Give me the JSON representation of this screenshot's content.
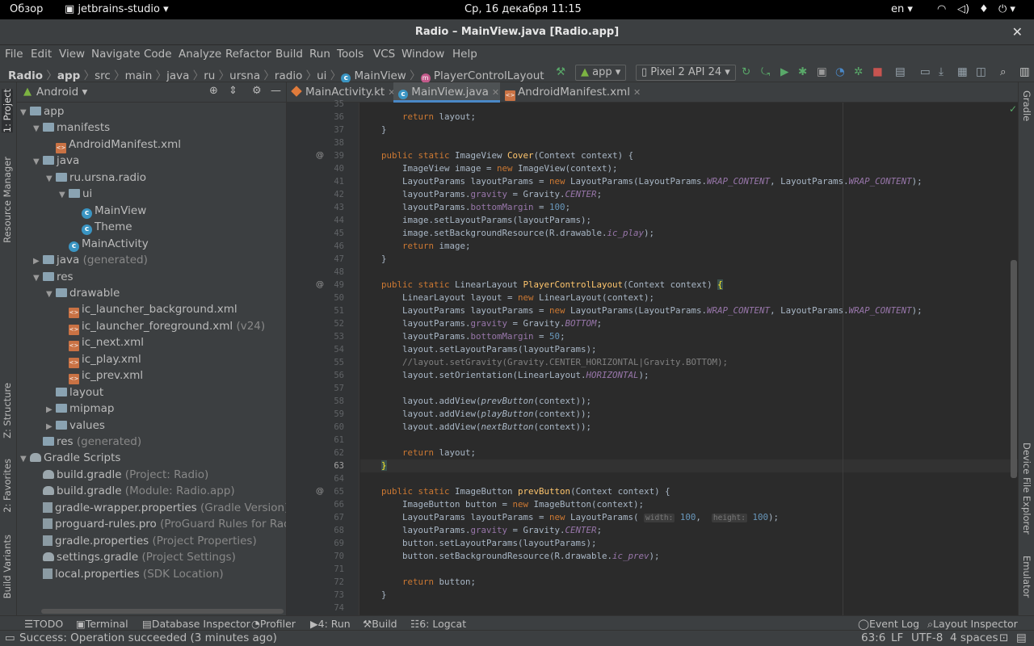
{
  "system_bar": {
    "overview": "Обзор",
    "app_name": "jetbrains-studio",
    "datetime": "Ср, 16 декабря  11:15",
    "lang": "en"
  },
  "window": {
    "title": "Radio – MainView.java [Radio.app]"
  },
  "menu": [
    "File",
    "Edit",
    "View",
    "Navigate",
    "Code",
    "Analyze",
    "Refactor",
    "Build",
    "Run",
    "Tools",
    "VCS",
    "Window",
    "Help"
  ],
  "breadcrumb": [
    "Radio",
    "app",
    "src",
    "main",
    "java",
    "ru",
    "ursna",
    "radio",
    "ui",
    "MainView",
    "PlayerControlLayout"
  ],
  "run_config": {
    "module": "app",
    "device": "Pixel 2 API 24"
  },
  "left_stripe": [
    "1: Project",
    "Resource Manager",
    "Z: Structure",
    "2: Favorites",
    "Build Variants"
  ],
  "right_stripe": [
    "Gradle",
    "Device File Explorer",
    "Emulator"
  ],
  "project_view": "Android",
  "tree": [
    {
      "label": "app",
      "hint": "",
      "depth": 0,
      "arrow": "▼",
      "icon": "folder"
    },
    {
      "label": "manifests",
      "hint": "",
      "depth": 1,
      "arrow": "▼",
      "icon": "folder"
    },
    {
      "label": "AndroidManifest.xml",
      "hint": "",
      "depth": 2,
      "arrow": "",
      "icon": "xml"
    },
    {
      "label": "java",
      "hint": "",
      "depth": 1,
      "arrow": "▼",
      "icon": "folder"
    },
    {
      "label": "ru.ursna.radio",
      "hint": "",
      "depth": 2,
      "arrow": "▼",
      "icon": "folder"
    },
    {
      "label": "ui",
      "hint": "",
      "depth": 3,
      "arrow": "▼",
      "icon": "folder"
    },
    {
      "label": "MainView",
      "hint": "",
      "depth": 4,
      "arrow": "",
      "icon": "class"
    },
    {
      "label": "Theme",
      "hint": "",
      "depth": 4,
      "arrow": "",
      "icon": "class"
    },
    {
      "label": "MainActivity",
      "hint": "",
      "depth": 3,
      "arrow": "",
      "icon": "class"
    },
    {
      "label": "java",
      "hint": " (generated)",
      "depth": 1,
      "arrow": "▶",
      "icon": "folder"
    },
    {
      "label": "res",
      "hint": "",
      "depth": 1,
      "arrow": "▼",
      "icon": "folder"
    },
    {
      "label": "drawable",
      "hint": "",
      "depth": 2,
      "arrow": "▼",
      "icon": "folder"
    },
    {
      "label": "ic_launcher_background.xml",
      "hint": "",
      "depth": 3,
      "arrow": "",
      "icon": "xml"
    },
    {
      "label": "ic_launcher_foreground.xml",
      "hint": " (v24)",
      "depth": 3,
      "arrow": "",
      "icon": "xml"
    },
    {
      "label": "ic_next.xml",
      "hint": "",
      "depth": 3,
      "arrow": "",
      "icon": "xml"
    },
    {
      "label": "ic_play.xml",
      "hint": "",
      "depth": 3,
      "arrow": "",
      "icon": "xml"
    },
    {
      "label": "ic_prev.xml",
      "hint": "",
      "depth": 3,
      "arrow": "",
      "icon": "xml"
    },
    {
      "label": "layout",
      "hint": "",
      "depth": 2,
      "arrow": "",
      "icon": "folder"
    },
    {
      "label": "mipmap",
      "hint": "",
      "depth": 2,
      "arrow": "▶",
      "icon": "folder"
    },
    {
      "label": "values",
      "hint": "",
      "depth": 2,
      "arrow": "▶",
      "icon": "folder"
    },
    {
      "label": "res",
      "hint": " (generated)",
      "depth": 1,
      "arrow": "",
      "icon": "folder"
    },
    {
      "label": "Gradle Scripts",
      "hint": "",
      "depth": 0,
      "arrow": "▼",
      "icon": "gradle"
    },
    {
      "label": "build.gradle",
      "hint": " (Project: Radio)",
      "depth": 1,
      "arrow": "",
      "icon": "gradle"
    },
    {
      "label": "build.gradle",
      "hint": " (Module: Radio.app)",
      "depth": 1,
      "arrow": "",
      "icon": "gradle"
    },
    {
      "label": "gradle-wrapper.properties",
      "hint": " (Gradle Version)",
      "depth": 1,
      "arrow": "",
      "icon": "props"
    },
    {
      "label": "proguard-rules.pro",
      "hint": " (ProGuard Rules for Radio.a",
      "depth": 1,
      "arrow": "",
      "icon": "props"
    },
    {
      "label": "gradle.properties",
      "hint": " (Project Properties)",
      "depth": 1,
      "arrow": "",
      "icon": "props"
    },
    {
      "label": "settings.gradle",
      "hint": " (Project Settings)",
      "depth": 1,
      "arrow": "",
      "icon": "gradle"
    },
    {
      "label": "local.properties",
      "hint": " (SDK Location)",
      "depth": 1,
      "arrow": "",
      "icon": "props"
    }
  ],
  "tabs": [
    {
      "label": "MainActivity.kt",
      "active": false,
      "icon": "kotlin"
    },
    {
      "label": "MainView.java",
      "active": true,
      "icon": "class"
    },
    {
      "label": "AndroidManifest.xml",
      "active": false,
      "icon": "xml"
    }
  ],
  "code_lines": [
    {
      "n": "35",
      "html": ""
    },
    {
      "n": "36",
      "html": "        <span class=\"kw\">return</span> layout;"
    },
    {
      "n": "37",
      "html": "    }"
    },
    {
      "n": "38",
      "html": ""
    },
    {
      "n": "39",
      "html": "    <span class=\"kw\">public static</span> ImageView <span class=\"fn\">Cover</span>(Context context) {",
      "mark": "@"
    },
    {
      "n": "40",
      "html": "        ImageView image = <span class=\"kw\">new</span> ImageView(context);"
    },
    {
      "n": "41",
      "html": "        LayoutParams layoutParams = <span class=\"kw\">new</span> LayoutParams(LayoutParams.<span class=\"st\">WRAP_CONTENT</span>, LayoutParams.<span class=\"st\">WRAP_CONTENT</span>);"
    },
    {
      "n": "42",
      "html": "        layoutParams.<span class=\"st\" style=\"font-style:normal\">gravity</span> = Gravity.<span class=\"st\">CENTER</span>;"
    },
    {
      "n": "43",
      "html": "        layoutParams.<span class=\"st\" style=\"font-style:normal\">bottomMargin</span> = <span class=\"num\">100</span>;"
    },
    {
      "n": "44",
      "html": "        image.setLayoutParams(layoutParams);"
    },
    {
      "n": "45",
      "html": "        image.setBackgroundResource(R.drawable.<span class=\"st\">ic_play</span>);"
    },
    {
      "n": "46",
      "html": "        <span class=\"kw\">return</span> image;"
    },
    {
      "n": "47",
      "html": "    }"
    },
    {
      "n": "48",
      "html": ""
    },
    {
      "n": "49",
      "html": "    <span class=\"kw\">public static</span> LinearLayout <span class=\"fn\">PlayerControlLayout</span>(Context context) <span style=\"background:#3b514d;color:#ffef28\">{</span>",
      "mark": "@"
    },
    {
      "n": "50",
      "html": "        LinearLayout layout = <span class=\"kw\">new</span> LinearLayout(context);"
    },
    {
      "n": "51",
      "html": "        LayoutParams layoutParams = <span class=\"kw\">new</span> LayoutParams(LayoutParams.<span class=\"st\">WRAP_CONTENT</span>, LayoutParams.<span class=\"st\">WRAP_CONTENT</span>);"
    },
    {
      "n": "52",
      "html": "        layoutParams.<span class=\"st\" style=\"font-style:normal\">gravity</span> = Gravity.<span class=\"st\">BOTTOM</span>;"
    },
    {
      "n": "53",
      "html": "        layoutParams.<span class=\"st\" style=\"font-style:normal\">bottomMargin</span> = <span class=\"num\">50</span>;"
    },
    {
      "n": "54",
      "html": "        layout.setLayoutParams(layoutParams);"
    },
    {
      "n": "55",
      "html": "        <span class=\"cm\">//layout.setGravity(Gravity.CENTER_HORIZONTAL|Gravity.BOTTOM);</span>"
    },
    {
      "n": "56",
      "html": "        layout.setOrientation(LinearLayout.<span class=\"st\">HORIZONTAL</span>);"
    },
    {
      "n": "57",
      "html": ""
    },
    {
      "n": "58",
      "html": "        layout.addView(<span style=\"font-style:italic\">prevButton</span>(context));"
    },
    {
      "n": "59",
      "html": "        layout.addView(<span style=\"font-style:italic\">playButton</span>(context));"
    },
    {
      "n": "60",
      "html": "        layout.addView(<span style=\"font-style:italic\">nextButton</span>(context));"
    },
    {
      "n": "61",
      "html": ""
    },
    {
      "n": "62",
      "html": "        <span class=\"kw\">return</span> layout;"
    },
    {
      "n": "63",
      "html": "    <span style=\"background:#3b514d;color:#ffef28\">}</span>",
      "current": true
    },
    {
      "n": "64",
      "html": ""
    },
    {
      "n": "65",
      "html": "    <span class=\"kw\">public static</span> ImageButton <span class=\"fn\">prevButton</span>(Context context) {",
      "mark": "@"
    },
    {
      "n": "66",
      "html": "        ImageButton button = <span class=\"kw\">new</span> ImageButton(context);"
    },
    {
      "n": "67",
      "html": "        LayoutParams layoutParams = <span class=\"kw\">new</span> LayoutParams( <span class=\"ph\">width:</span> <span class=\"num\">100</span>,  <span class=\"ph\">height:</span> <span class=\"num\">100</span>);"
    },
    {
      "n": "68",
      "html": "        layoutParams.<span class=\"st\" style=\"font-style:normal\">gravity</span> = Gravity.<span class=\"st\">CENTER</span>;"
    },
    {
      "n": "69",
      "html": "        button.setLayoutParams(layoutParams);"
    },
    {
      "n": "70",
      "html": "        button.setBackgroundResource(R.drawable.<span class=\"st\">ic_prev</span>);"
    },
    {
      "n": "71",
      "html": ""
    },
    {
      "n": "72",
      "html": "        <span class=\"kw\">return</span> button;"
    },
    {
      "n": "73",
      "html": "    }"
    },
    {
      "n": "74",
      "html": ""
    }
  ],
  "bottom_tools": {
    "todo": "TODO",
    "terminal": "Terminal",
    "db": "Database Inspector",
    "profiler": "Profiler",
    "run": "4: Run",
    "build": "Build",
    "logcat": "6: Logcat",
    "eventlog": "Event Log",
    "layout_inspector": "Layout Inspector"
  },
  "status": {
    "message": "Success: Operation succeeded (3 minutes ago)",
    "position": "63:6",
    "line_sep": "LF",
    "encoding": "UTF-8",
    "indent": "4 spaces"
  }
}
